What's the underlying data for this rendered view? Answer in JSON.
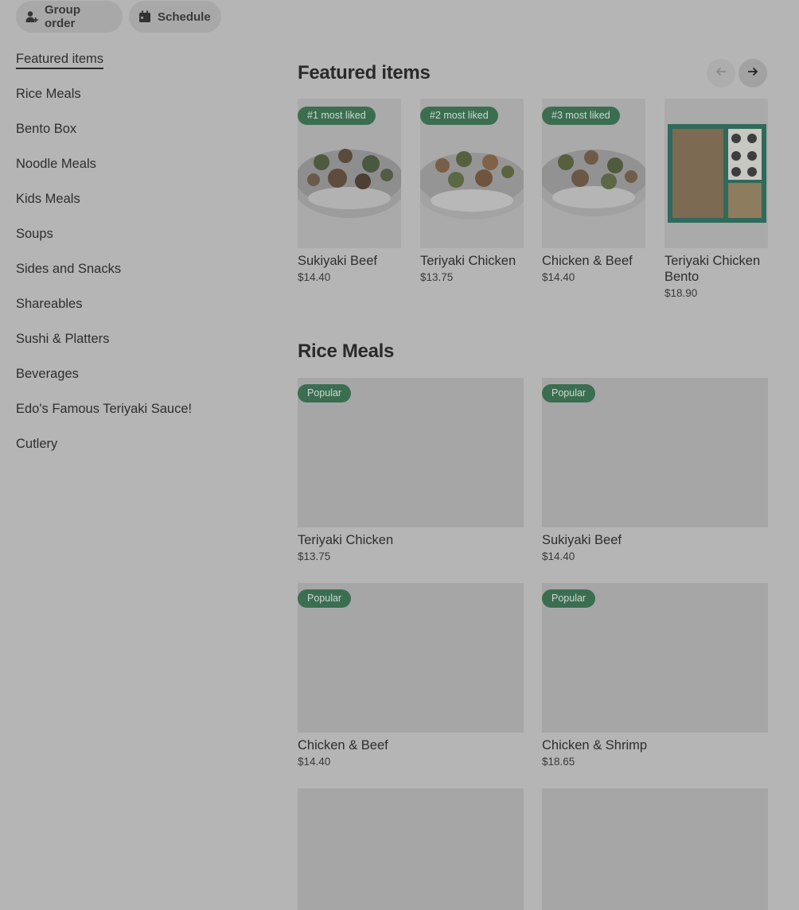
{
  "toolbar": {
    "group_order": "Group order",
    "schedule": "Schedule"
  },
  "sidebar": {
    "items": [
      {
        "label": "Featured items"
      },
      {
        "label": "Rice Meals"
      },
      {
        "label": "Bento Box"
      },
      {
        "label": "Noodle Meals"
      },
      {
        "label": "Kids Meals"
      },
      {
        "label": "Soups"
      },
      {
        "label": "Sides and Snacks"
      },
      {
        "label": "Shareables"
      },
      {
        "label": "Sushi & Platters"
      },
      {
        "label": "Beverages"
      },
      {
        "label": "Edo's Famous Teriyaki Sauce!"
      },
      {
        "label": "Cutlery"
      }
    ]
  },
  "featured": {
    "title": "Featured items",
    "items": [
      {
        "badge": "#1 most liked",
        "name": "Sukiyaki Beef",
        "price": "$14.40"
      },
      {
        "badge": "#2 most liked",
        "name": "Teriyaki Chicken",
        "price": "$13.75"
      },
      {
        "badge": "#3 most liked",
        "name": "Chicken & Beef",
        "price": "$14.40"
      },
      {
        "badge": "",
        "name": "Teriyaki Chicken Bento",
        "price": "$18.90"
      }
    ]
  },
  "rice_meals": {
    "title": "Rice Meals",
    "items": [
      {
        "badge": "Popular",
        "name": "Teriyaki Chicken",
        "price": "$13.75"
      },
      {
        "badge": "Popular",
        "name": "Sukiyaki Beef",
        "price": "$14.40"
      },
      {
        "badge": "Popular",
        "name": "Chicken & Beef",
        "price": "$14.40"
      },
      {
        "badge": "Popular",
        "name": "Chicken & Shrimp",
        "price": "$18.65"
      }
    ]
  },
  "colors": {
    "background": "#b5b5b5",
    "badge": "#3b6e50",
    "text": "#2e2e2e"
  }
}
